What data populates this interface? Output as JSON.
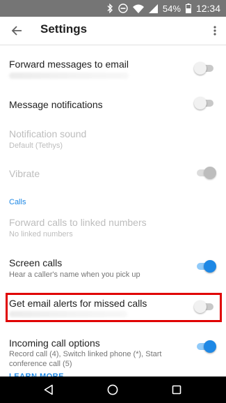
{
  "status_bar": {
    "battery": "54%",
    "time": "12:34",
    "icons": [
      "bluetooth-icon",
      "do-not-disturb-icon",
      "wifi-icon",
      "signal-icon",
      "battery-icon"
    ]
  },
  "app_bar": {
    "title": "Settings",
    "back_icon": "arrow-back-icon",
    "more_icon": "more-vert-icon"
  },
  "settings": {
    "forward_email": {
      "title": "Forward messages to email",
      "enabled": false
    },
    "message_notifications": {
      "title": "Message notifications",
      "enabled": false
    },
    "notification_sound": {
      "title": "Notification sound",
      "subtitle": "Default (Tethys)",
      "disabled": true
    },
    "vibrate": {
      "title": "Vibrate",
      "enabled": true,
      "disabled": true
    }
  },
  "calls": {
    "header": "Calls",
    "forward_calls": {
      "title": "Forward calls to linked numbers",
      "subtitle": "No linked numbers",
      "disabled": true
    },
    "screen_calls": {
      "title": "Screen calls",
      "subtitle": "Hear a caller's name when you pick up",
      "enabled": true
    },
    "email_alerts": {
      "title": "Get email alerts for missed calls",
      "enabled": false
    },
    "incoming_options": {
      "title": "Incoming call options",
      "subtitle_line1": "Record call (4), Switch linked phone (*), Start",
      "subtitle_line2": "conference call (5)",
      "enabled": true,
      "link": "LEARN MORE"
    }
  },
  "colors": {
    "accent": "#1e88e5",
    "highlight": "#e00000",
    "status_bar": "#757575",
    "nav_bar": "#000000"
  },
  "nav_bar": {
    "icons": [
      "back-triangle-icon",
      "home-circle-icon",
      "recents-square-icon"
    ]
  }
}
